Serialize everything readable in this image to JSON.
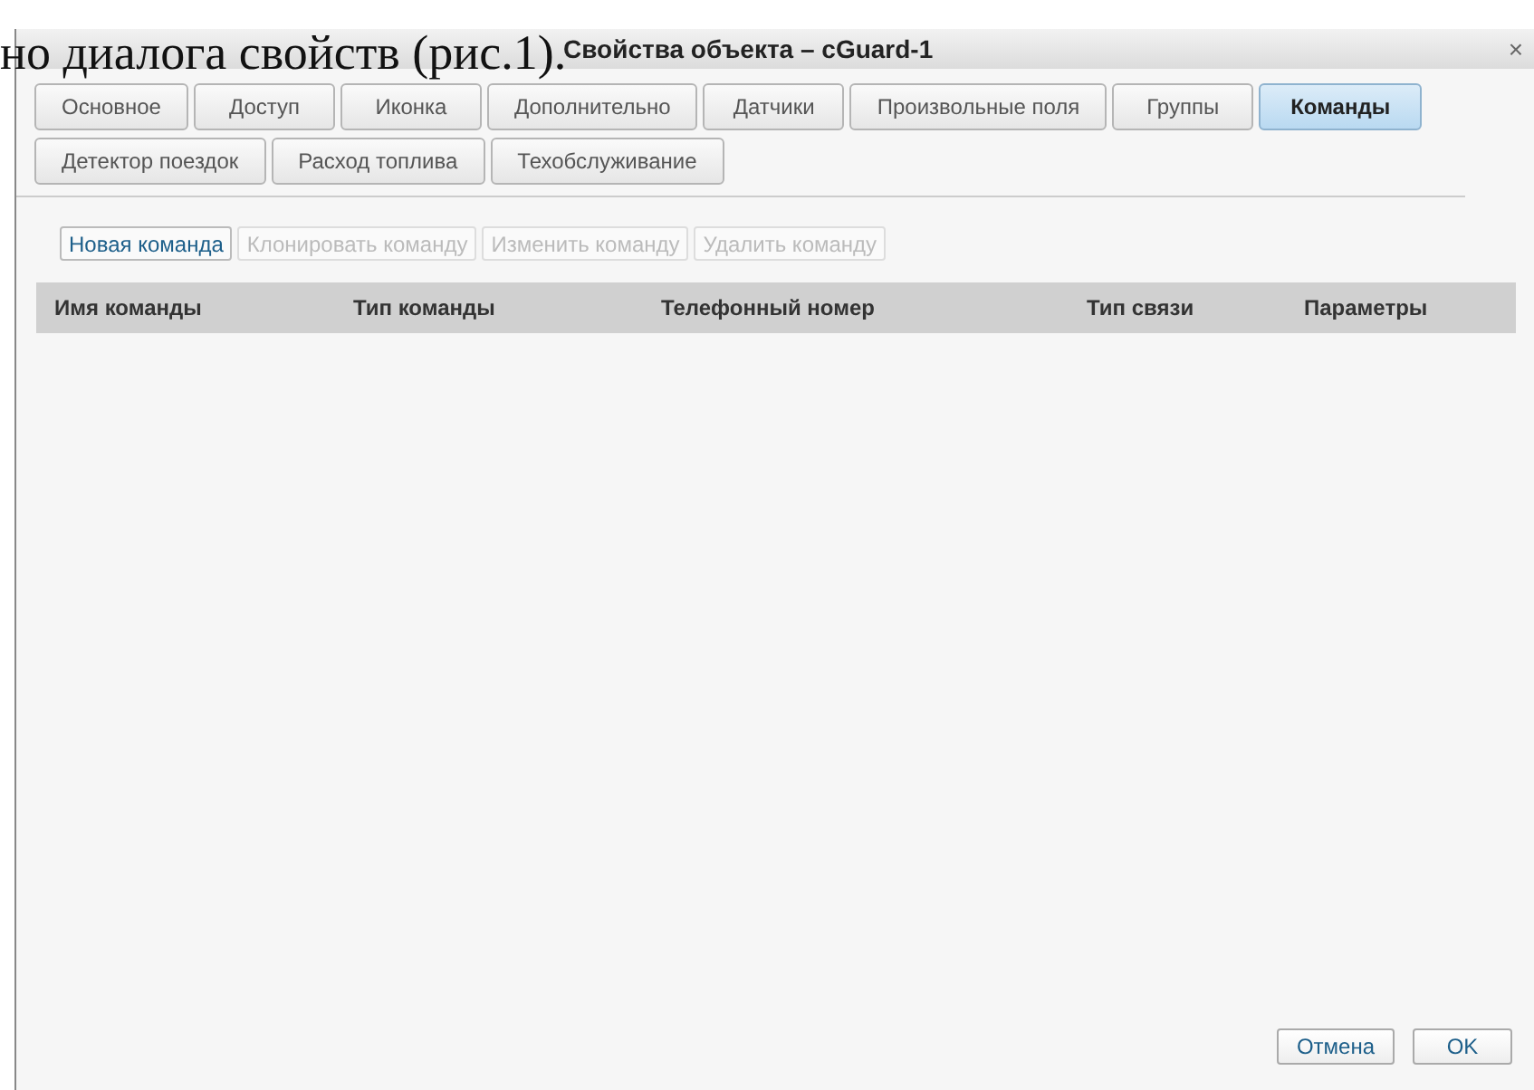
{
  "document_text": "но диалога свойств (рис.1).",
  "window": {
    "title": "Свойства объекта – cGuard-1",
    "close": "×"
  },
  "tabs": [
    {
      "label": "Основное",
      "selected": false
    },
    {
      "label": "Доступ",
      "selected": false
    },
    {
      "label": "Иконка",
      "selected": false
    },
    {
      "label": "Дополнительно",
      "selected": false
    },
    {
      "label": "Датчики",
      "selected": false
    },
    {
      "label": "Произвольные поля",
      "selected": false
    },
    {
      "label": "Группы",
      "selected": false
    },
    {
      "label": "Команды",
      "selected": true
    },
    {
      "label": "Детектор поездок",
      "selected": false
    },
    {
      "label": "Расход топлива",
      "selected": false
    },
    {
      "label": "Техобслуживание",
      "selected": false
    }
  ],
  "toolbar": [
    {
      "label": "Новая команда",
      "disabled": false
    },
    {
      "label": "Клонировать команду",
      "disabled": true
    },
    {
      "label": "Изменить команду",
      "disabled": true
    },
    {
      "label": "Удалить команду",
      "disabled": true
    }
  ],
  "table": {
    "columns": [
      "Имя команды",
      "Тип команды",
      "Телефонный номер",
      "Тип связи",
      "Параметры"
    ]
  },
  "buttons": [
    "Отмена",
    "OK"
  ]
}
